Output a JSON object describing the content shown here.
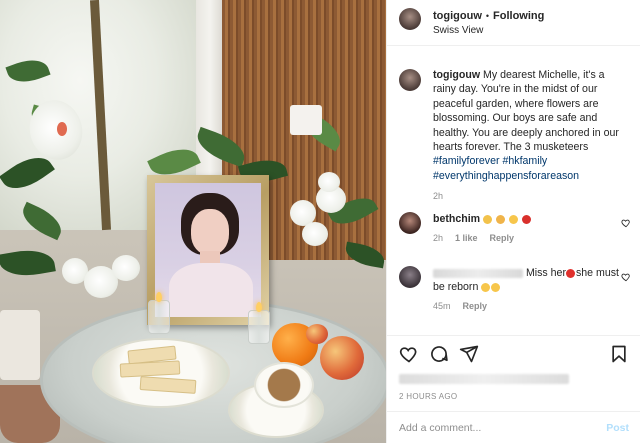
{
  "post": {
    "username": "togigouw",
    "follow_status": "Following",
    "separator": "•",
    "location": "Swiss View"
  },
  "caption": {
    "username": "togigouw",
    "text": "My dearest Michelle, it's a rainy day. You're in the midst of our peaceful garden, where flowers are blossoming. Our boys are safe and healthy. You are deeply anchored in our hearts forever. The 3 musketeers",
    "hashtags": [
      "#familyforever",
      "#hkfamily",
      "#everythinghappensforareason"
    ],
    "time": "2h"
  },
  "comments": [
    {
      "username": "bethchim",
      "text_icons": [
        "praying-hands",
        "flexed-biceps",
        "heart-eyes",
        "rose"
      ],
      "time": "2h",
      "likes": "1 like",
      "reply": "Reply"
    },
    {
      "username_hidden": true,
      "text_a": "Miss her",
      "text_b": "she must be reborn",
      "emoji_after_a": "red-heart",
      "emoji_end": [
        "smiling-face-with-hearts",
        "smiling-face-with-hearts"
      ],
      "time": "45m",
      "reply": "Reply"
    }
  ],
  "footer": {
    "time_ago": "2 HOURS AGO",
    "add_comment_placeholder": "Add a comment...",
    "post_label": "Post"
  },
  "colors": {
    "hashtag": "#00376b",
    "muted": "#8e8e8e",
    "post_button": "#b2dffc",
    "text": "#262626"
  }
}
